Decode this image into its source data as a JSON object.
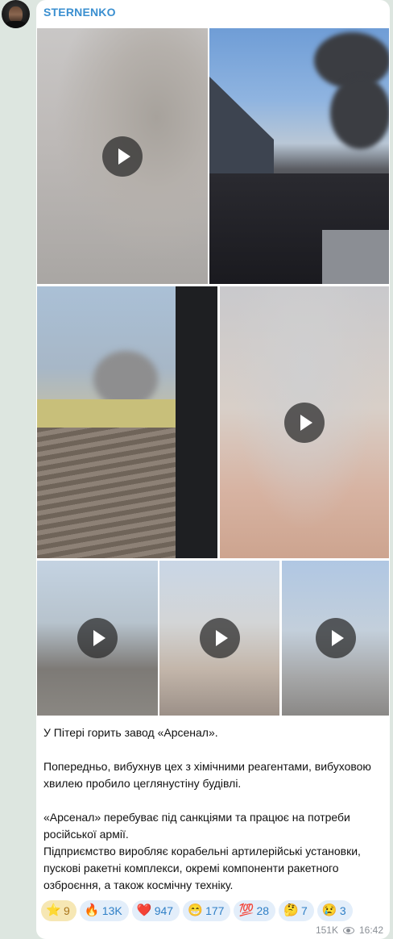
{
  "channel": {
    "name": "STERNENKO"
  },
  "post": {
    "paragraphs": [
      "У Пітері горить завод «Арсенал».",
      "Попередньо, вибухнув цех з хімічними реагентами, вибуховою хвилею пробило цеглянустіну будівлі.",
      "«Арсенал» перебуває під санкціями та працює на потреби російської армії.",
      "Підприємство виробляє корабельні артилерійські установки, пускові ракетні комплекси, окремі компоненти ракетного озброєння, а також космічну техніку."
    ]
  },
  "media": [
    {
      "kind": "video"
    },
    {
      "kind": "photo"
    },
    {
      "kind": "photo"
    },
    {
      "kind": "video"
    },
    {
      "kind": "video"
    },
    {
      "kind": "video"
    },
    {
      "kind": "video"
    }
  ],
  "reactions": [
    {
      "emoji": "⭐",
      "icon": "star-icon",
      "count": "9"
    },
    {
      "emoji": "🔥",
      "icon": "fire-icon",
      "count": "13K"
    },
    {
      "emoji": "❤️",
      "icon": "heart-icon",
      "count": "947"
    },
    {
      "emoji": "😁",
      "icon": "grin-icon",
      "count": "177"
    },
    {
      "emoji": "💯",
      "icon": "hundred-icon",
      "count": "28"
    },
    {
      "emoji": "🤔",
      "icon": "thinking-icon",
      "count": "7"
    },
    {
      "emoji": "😢",
      "icon": "crying-icon",
      "count": "3"
    }
  ],
  "meta": {
    "views": "151K",
    "time": "16:42"
  }
}
